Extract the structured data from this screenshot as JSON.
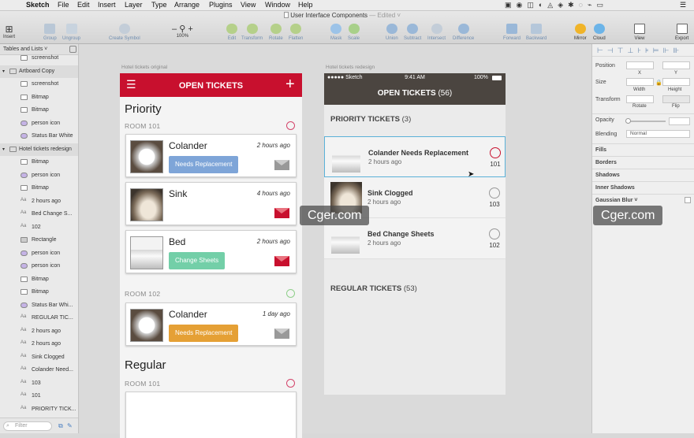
{
  "menu": {
    "apple": "",
    "app": "Sketch",
    "items": [
      "File",
      "Edit",
      "Insert",
      "Layer",
      "Type",
      "Arrange",
      "Plugins",
      "View",
      "Window",
      "Help"
    ],
    "clock": ""
  },
  "window": {
    "title": "User Interface Components",
    "edited": "— Edited ˅"
  },
  "toolbar": {
    "insert": "Insert",
    "group": "Group",
    "ungroup": "Ungroup",
    "create_symbol": "Create Symbol",
    "zoom": "100%",
    "zoom_minus": "–",
    "zoom_plus": "+",
    "edit": "Edit",
    "transform": "Transform",
    "rotate": "Rotate",
    "flatten": "Flatten",
    "mask": "Mask",
    "scale": "Scale",
    "union": "Union",
    "subtract": "Subtract",
    "intersect": "Intersect",
    "difference": "Difference",
    "forward": "Forward",
    "backward": "Backward",
    "mirror": "Mirror",
    "cloud": "Cloud",
    "view": "View",
    "export": "Export"
  },
  "sidebar": {
    "page_label": "Tables and Lists ˅",
    "filter_placeholder": "Filter",
    "layers": [
      {
        "name": "screenshot",
        "indent": 2,
        "icon": "bitmap-icon"
      },
      {
        "name": "Artboard Copy",
        "indent": 1,
        "icon": "artboard-icon",
        "group": true
      },
      {
        "name": "screenshot",
        "indent": 2,
        "icon": "bitmap-icon"
      },
      {
        "name": "Bitmap",
        "indent": 2,
        "icon": "bitmap-icon"
      },
      {
        "name": "Bitmap",
        "indent": 2,
        "icon": "bitmap-icon"
      },
      {
        "name": "person icon",
        "indent": 2,
        "icon": "symbol-icon"
      },
      {
        "name": "Status Bar White",
        "indent": 2,
        "icon": "symbol-icon"
      },
      {
        "name": "Hotel tickets redesign",
        "indent": 1,
        "icon": "artboard-icon",
        "group": true
      },
      {
        "name": "Bitmap",
        "indent": 2,
        "icon": "bitmap-icon"
      },
      {
        "name": "person icon",
        "indent": 2,
        "icon": "symbol-icon"
      },
      {
        "name": "Bitmap",
        "indent": 2,
        "icon": "bitmap-icon"
      },
      {
        "name": "2 hours ago",
        "indent": 2,
        "icon": "text-icon"
      },
      {
        "name": "Bed Change S...",
        "indent": 2,
        "icon": "text-icon"
      },
      {
        "name": "102",
        "indent": 2,
        "icon": "text-icon"
      },
      {
        "name": "Rectangle",
        "indent": 2,
        "icon": "rectangle-icon"
      },
      {
        "name": "person icon",
        "indent": 2,
        "icon": "symbol-icon"
      },
      {
        "name": "person icon",
        "indent": 2,
        "icon": "symbol-icon"
      },
      {
        "name": "Bitmap",
        "indent": 2,
        "icon": "bitmap-icon"
      },
      {
        "name": "Bitmap",
        "indent": 2,
        "icon": "bitmap-icon"
      },
      {
        "name": "Status Bar Whi...",
        "indent": 2,
        "icon": "symbol-icon"
      },
      {
        "name": "REGULAR TIC...",
        "indent": 2,
        "icon": "text-icon"
      },
      {
        "name": "2 hours ago",
        "indent": 2,
        "icon": "text-icon"
      },
      {
        "name": "2 hours ago",
        "indent": 2,
        "icon": "text-icon"
      },
      {
        "name": "Sink Clogged",
        "indent": 2,
        "icon": "text-icon"
      },
      {
        "name": "Colander Need...",
        "indent": 2,
        "icon": "text-icon"
      },
      {
        "name": "103",
        "indent": 2,
        "icon": "text-icon"
      },
      {
        "name": "101",
        "indent": 2,
        "icon": "text-icon"
      },
      {
        "name": "PRIORITY TICK...",
        "indent": 2,
        "icon": "text-icon"
      }
    ]
  },
  "artboard_left": {
    "label": "Hotel tickets original",
    "header": "OPEN TICKETS",
    "header_color": "#c8102e",
    "sections": [
      {
        "title": "Priority",
        "room": "ROOM 101"
      },
      {
        "room": "ROOM 102"
      },
      {
        "title": "Regular",
        "room": "ROOM 101"
      }
    ],
    "cards": [
      {
        "name": "Colander",
        "time": "2 hours ago",
        "tag": "Needs Replacement",
        "tag_color": "#7ea5d8"
      },
      {
        "name": "Sink",
        "time": "4 hours ago",
        "tag": "",
        "tag_color": ""
      },
      {
        "name": "Bed",
        "time": "2 hours ago",
        "tag": "Change Sheets",
        "tag_color": "#73cfa8"
      },
      {
        "name": "Colander",
        "time": "1 day ago",
        "tag": "Needs Replacement",
        "tag_color": "#e5a035"
      }
    ]
  },
  "artboard_right": {
    "label": "Hotel tickets redesign",
    "status_carrier": "●●●●● Sketch",
    "status_time": "9:41 AM",
    "status_battery": "100%",
    "header": "OPEN TICKETS",
    "header_count": "(56)",
    "priority_label": "PRIORITY TICKETS",
    "priority_count": "(3)",
    "regular_label": "REGULAR TICKETS",
    "regular_count": "(53)",
    "rows": [
      {
        "name": "Colander Needs Replacement",
        "time": "2 hours ago",
        "room": "101"
      },
      {
        "name": "Sink Clogged",
        "time": "2 hours ago",
        "room": "103"
      },
      {
        "name": "Bed Change Sheets",
        "time": "2 hours ago",
        "room": "102"
      }
    ]
  },
  "inspector": {
    "position": "Position",
    "x": "X",
    "y": "Y",
    "size": "Size",
    "width": "Width",
    "height": "Height",
    "transform": "Transform",
    "rotate": "Rotate",
    "flip": "Flip",
    "opacity": "Opacity",
    "blending": "Blending",
    "blending_value": "Normal",
    "sections": [
      "Fills",
      "Borders",
      "Shadows",
      "Inner Shadows",
      "Gaussian Blur ˅"
    ]
  },
  "watermarks": [
    "Cger.com",
    "Cger.com"
  ]
}
